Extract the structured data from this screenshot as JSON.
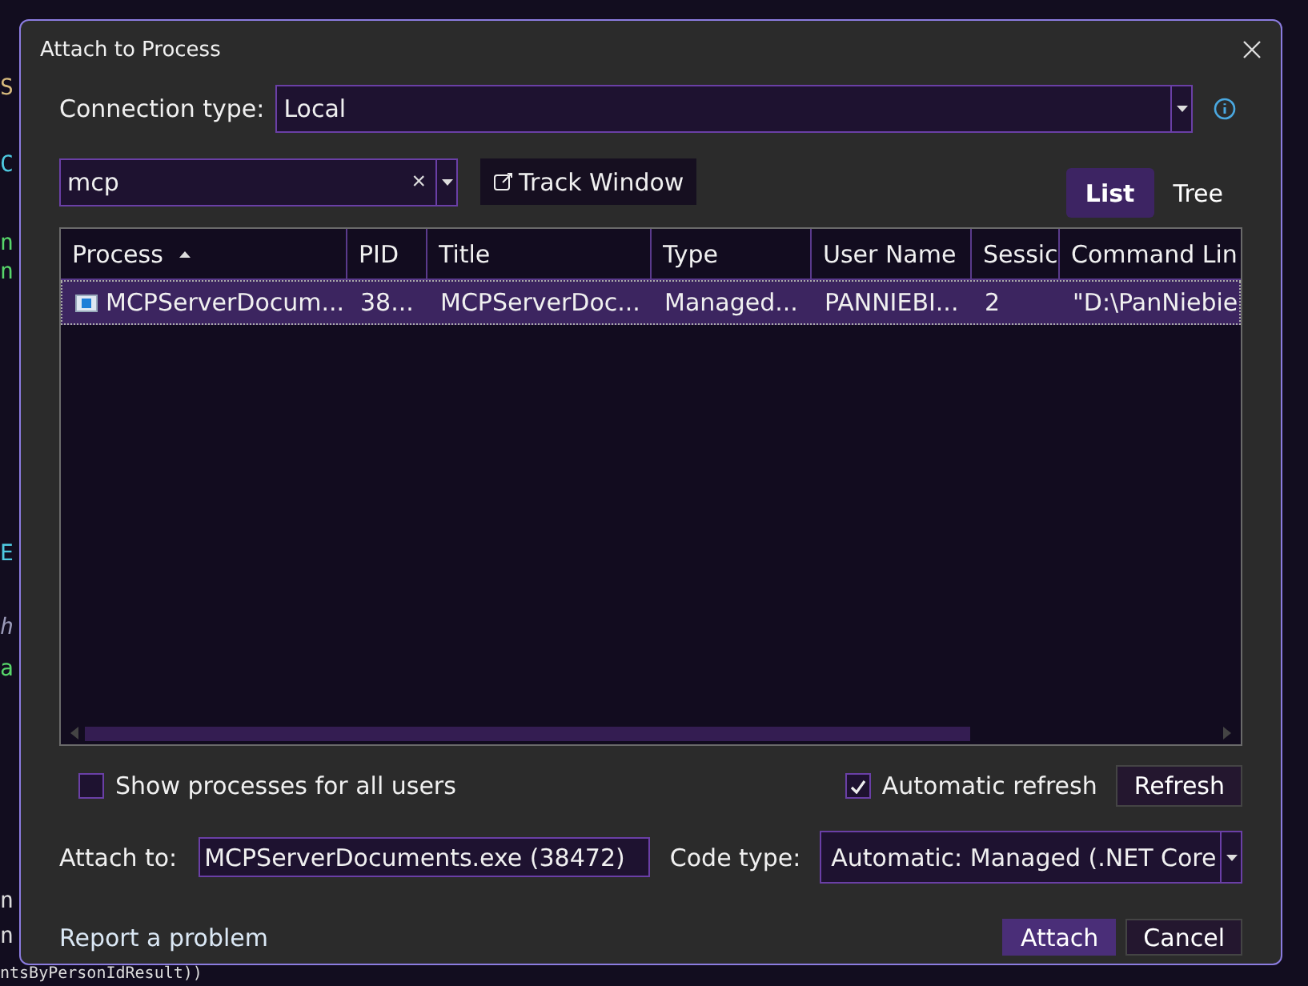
{
  "editor": {
    "lines": [
      {
        "text": "S",
        "kind": "string"
      },
      {
        "text": "C",
        "kind": "type"
      },
      {
        "text": "n",
        "kind": "local"
      },
      {
        "text": "n",
        "kind": "local"
      },
      {
        "text": "E",
        "kind": "type"
      },
      {
        "text": "h",
        "kind": "comment"
      },
      {
        "text": "a",
        "kind": "local"
      },
      {
        "text": "n",
        "kind": "plain"
      },
      {
        "text": "n",
        "kind": "plain"
      },
      {
        "text": "ntsByPersonIdResult))",
        "kind": "plain"
      }
    ]
  },
  "window": {
    "title": "Attach to Process"
  },
  "connection": {
    "label": "Connection type:",
    "value": "Local"
  },
  "filter": {
    "value": "mcp",
    "clear": "×"
  },
  "track_window": {
    "label": "Track Window"
  },
  "view_tabs": [
    {
      "label": "List",
      "selected": true
    },
    {
      "label": "Tree",
      "selected": false
    }
  ],
  "table": {
    "columns": [
      {
        "label": "Process",
        "sorted": true
      },
      {
        "label": "PID",
        "sorted": false
      },
      {
        "label": "Title",
        "sorted": false
      },
      {
        "label": "Type",
        "sorted": false
      },
      {
        "label": "User Name",
        "sorted": false
      },
      {
        "label": "Sessic",
        "sorted": false
      },
      {
        "label": "Command Lin",
        "sorted": false
      }
    ],
    "rows": [
      {
        "selected": true,
        "cells": [
          "MCPServerDocum...",
          "38...",
          "MCPServerDoc...",
          "Managed...",
          "PANNIEBI...",
          "2",
          "\"D:\\PanNiebie"
        ]
      }
    ]
  },
  "show_all_users": {
    "label": "Show processes for all users",
    "checked": false
  },
  "auto_refresh": {
    "label": "Automatic refresh",
    "checked": true
  },
  "refresh_button": "Refresh",
  "attach_to": {
    "label": "Attach to:",
    "value": "MCPServerDocuments.exe (38472)"
  },
  "code_type": {
    "label": "Code type:",
    "value": "Automatic: Managed (.NET Core"
  },
  "report_link": "Report a problem",
  "buttons": [
    {
      "label": "Attach",
      "primary": true
    },
    {
      "label": "Cancel",
      "primary": false
    }
  ]
}
